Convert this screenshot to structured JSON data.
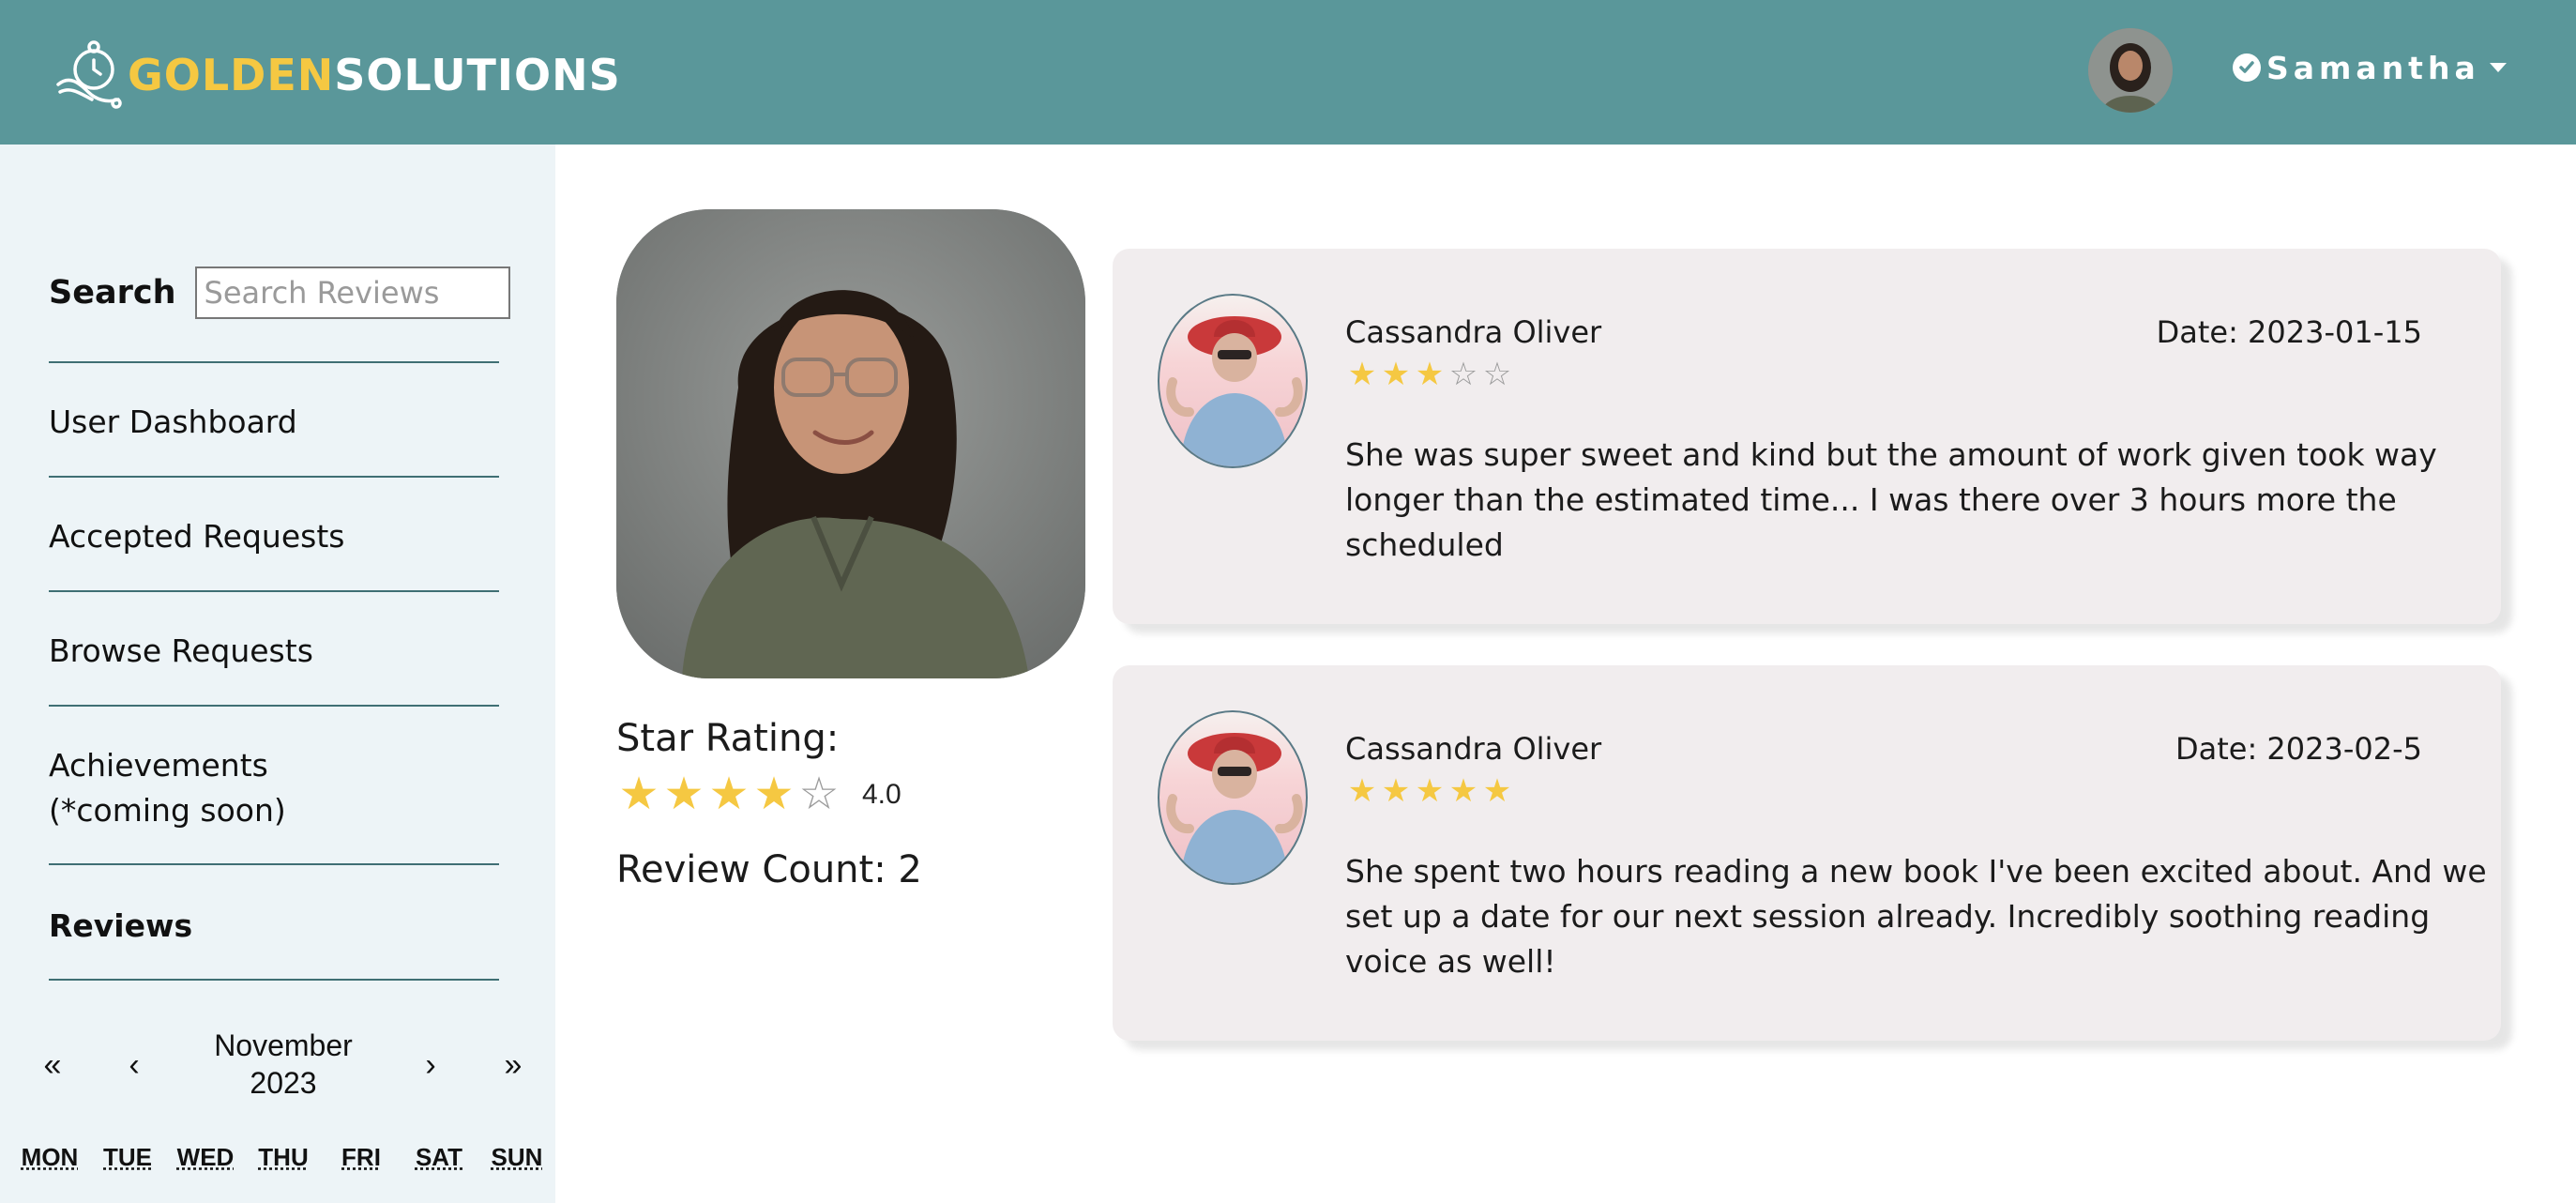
{
  "brand": {
    "name_gold": "GOLDEN",
    "name_white": "SOLUTIONS",
    "icon": "pocket-watch-logo-icon",
    "gold_color": "#f5c842"
  },
  "header": {
    "user_name": "Samantha",
    "verified_icon": "check-circle-icon",
    "menu_icon": "caret-down-icon",
    "background": "#5a979a"
  },
  "sidebar": {
    "search_label": "Search",
    "search_placeholder": "Search Reviews",
    "nav": [
      {
        "label": "User Dashboard",
        "active": false
      },
      {
        "label": "Accepted Requests",
        "active": false
      },
      {
        "label": "Browse Requests",
        "active": false
      },
      {
        "label": "Achievements\n(*coming soon)",
        "active": false
      },
      {
        "label": "Reviews",
        "active": true
      }
    ],
    "calendar": {
      "month_label": "November 2023",
      "prev_year": "«",
      "prev_month": "‹",
      "next_month": "›",
      "next_year": "»",
      "weekdays": [
        "MON",
        "TUE",
        "WED",
        "THU",
        "FRI",
        "SAT",
        "SUN"
      ]
    }
  },
  "profile": {
    "rating_label": "Star Rating:",
    "rating": 4,
    "rating_max": 5,
    "rating_value": "4.0",
    "review_count_label": "Review Count: 2"
  },
  "reviews": [
    {
      "name": "Cassandra Oliver",
      "date": "Date: 2023-01-15",
      "stars": 3,
      "text": "She was super sweet and kind but the amount of work given took way longer than the estimated time... I was there over 3 hours more the scheduled"
    },
    {
      "name": "Cassandra Oliver",
      "date": "Date: 2023-02-5",
      "stars": 5,
      "text": "She spent two hours reading a new book I've been excited about. And we set up a date for our next session already. Incredibly soothing reading voice as well!"
    }
  ]
}
